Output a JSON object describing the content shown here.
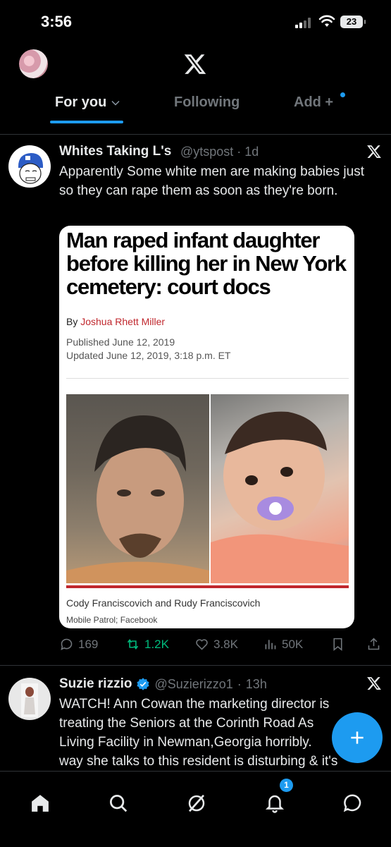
{
  "status_bar": {
    "time": "3:56",
    "battery": "23"
  },
  "header": {
    "logo": "X",
    "tabs": {
      "for_you": "For you",
      "following": "Following",
      "add": "Add +"
    }
  },
  "tweets": [
    {
      "name": "Whites Taking L's",
      "handle": "@ytspost",
      "time": "1d",
      "text": "Apparently Some white men are making babies just so they can rape them as soon as they're born.",
      "card": {
        "headline": "Man raped infant daughter before killing her in New York cemetery: court docs",
        "by_label": "By",
        "author": "Joshua Rhett Miller",
        "published": "Published June 12, 2019",
        "updated": "Updated June 12, 2019, 3:18 p.m. ET",
        "caption": "Cody Franciscovich and Rudy Franciscovich",
        "credit": "Mobile Patrol; Facebook"
      },
      "actions": {
        "replies": "169",
        "reposts": "1.2K",
        "likes": "3.8K",
        "views": "50K"
      }
    },
    {
      "name": "Suzie rizzio",
      "handle": "@Suzierizzo1",
      "time": "13h",
      "text_lines": [
        "WATCH! Ann Cowan the marketing director is",
        "treating the Seniors at the Corinth Road As",
        "Living Facility in Newman,Georgia horribly.",
        "way she talks to this resident is disturbing & it's"
      ]
    }
  ],
  "nav": {
    "notification_count": "1"
  },
  "colors": {
    "accent": "#1d9bf0",
    "background": "#000000",
    "muted": "#71767b",
    "repost_green": "#00ba7c",
    "headline_red": "#c0272d"
  }
}
